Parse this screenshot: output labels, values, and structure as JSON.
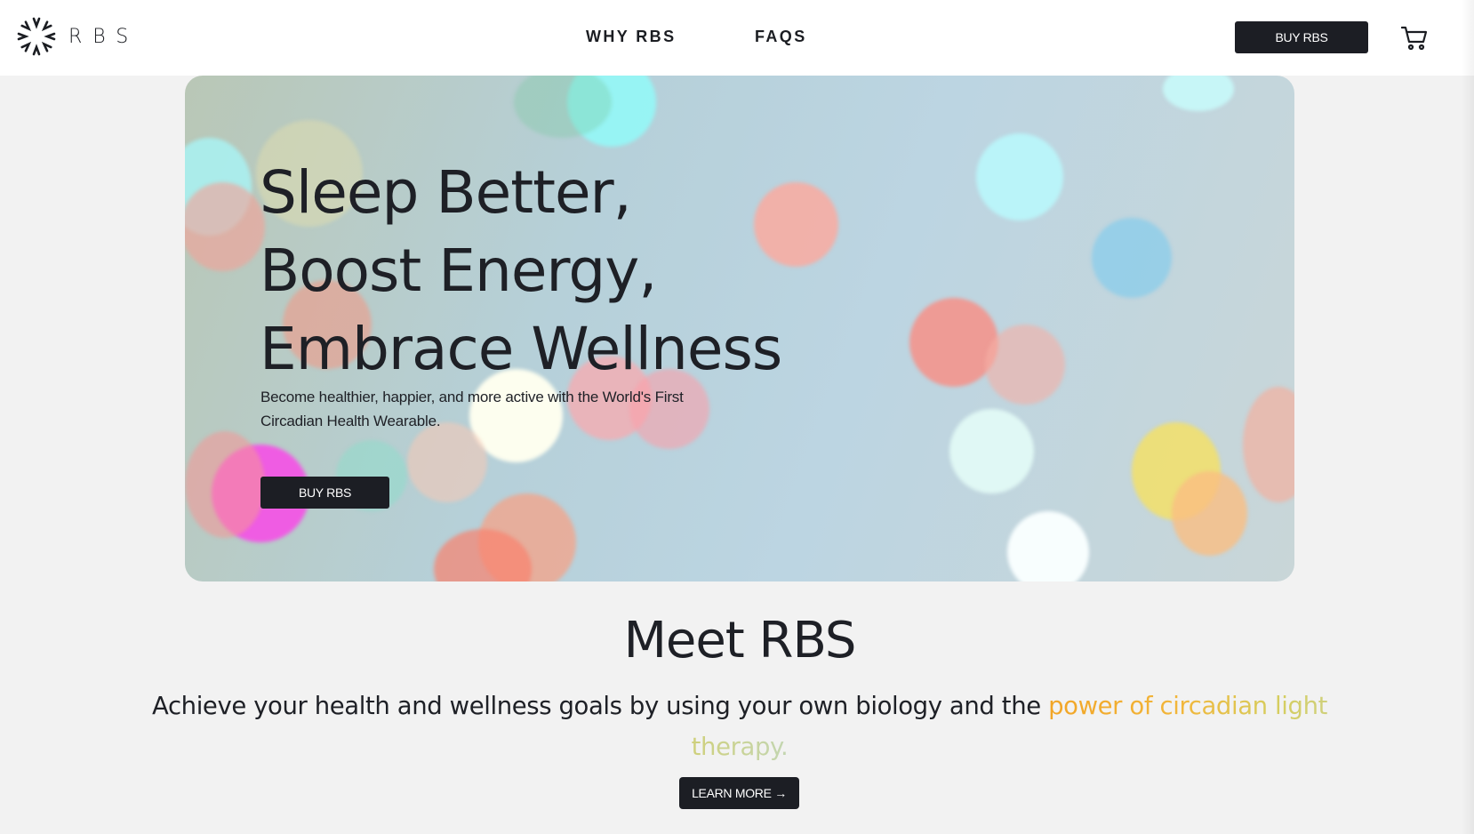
{
  "brand": {
    "logo_text": "RBS",
    "logo_icon": "starburst-logo-icon"
  },
  "nav": {
    "why": "WHY RBS",
    "faqs": "FAQS",
    "buy_label": "BUY RBS",
    "cart_icon": "shopping-cart-icon"
  },
  "hero": {
    "title_lines": [
      "Sleep Better,",
      "Boost Energy,",
      "Embrace Wellness"
    ],
    "subtitle": "Become healthier, happier, and more active with the World's First Circadian Health Wearable.",
    "buy_label": "BUY RBS"
  },
  "meet": {
    "title": "Meet RBS",
    "body_plain": "Achieve your health and wellness goals by using your own biology and the ",
    "body_highlight": "power of circadian light therapy.",
    "learn_more": "LEARN MORE →"
  },
  "colors": {
    "dark": "#1c1e24",
    "page_bg": "#f2f2f2",
    "highlight_start": "#f2a526",
    "highlight_end": "#c3d6b2"
  }
}
